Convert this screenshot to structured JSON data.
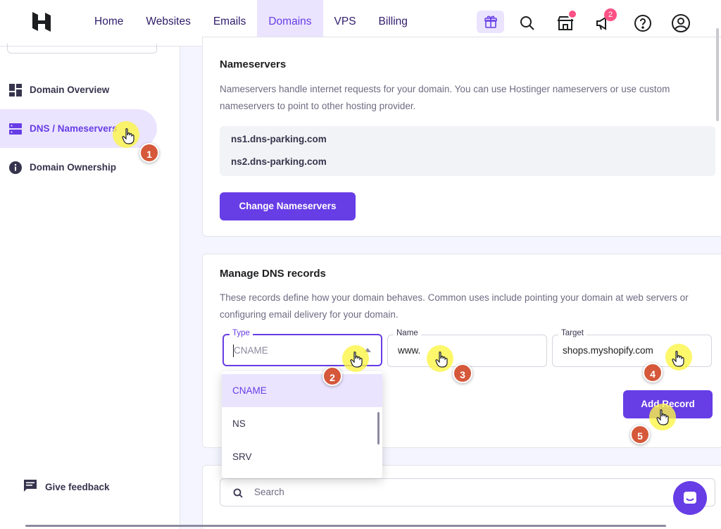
{
  "nav": {
    "items": [
      "Home",
      "Websites",
      "Emails",
      "Domains",
      "VPS",
      "Billing"
    ],
    "active": "Domains",
    "announcements_badge": "2"
  },
  "sidebar": {
    "items": [
      {
        "label": "Domain Overview",
        "icon": "dashboard-icon"
      },
      {
        "label": "DNS / Nameservers",
        "icon": "server-icon",
        "active": true
      },
      {
        "label": "Domain Ownership",
        "icon": "info-icon"
      }
    ],
    "feedback_label": "Give feedback"
  },
  "nameservers": {
    "title": "Nameservers",
    "description": "Nameservers handle internet requests for your domain. You can use Hostinger nameservers or use custom nameservers to point to other hosting provider.",
    "ns1": "ns1.dns-parking.com",
    "ns2": "ns2.dns-parking.com",
    "change_button": "Change Nameservers"
  },
  "dns": {
    "title": "Manage DNS records",
    "description": "These records define how your domain behaves. Common uses include pointing your domain at web servers or configuring email delivery for your domain.",
    "type_label": "Type",
    "type_placeholder": "CNAME",
    "name_label": "Name",
    "name_value": "www.",
    "target_label": "Target",
    "target_value": "shops.myshopify.com",
    "add_button": "Add Record",
    "type_options": [
      "CNAME",
      "NS",
      "SRV"
    ],
    "selected_option": "CNAME"
  },
  "records": {
    "search_placeholder": "Search"
  },
  "annotations": {
    "steps": [
      "1",
      "2",
      "3",
      "4",
      "5"
    ]
  },
  "colors": {
    "accent": "#673de6",
    "accent_light": "#ebe4ff",
    "badge": "#fc5185",
    "step_marker": "#d5583a",
    "highlight": "#fcf546"
  }
}
